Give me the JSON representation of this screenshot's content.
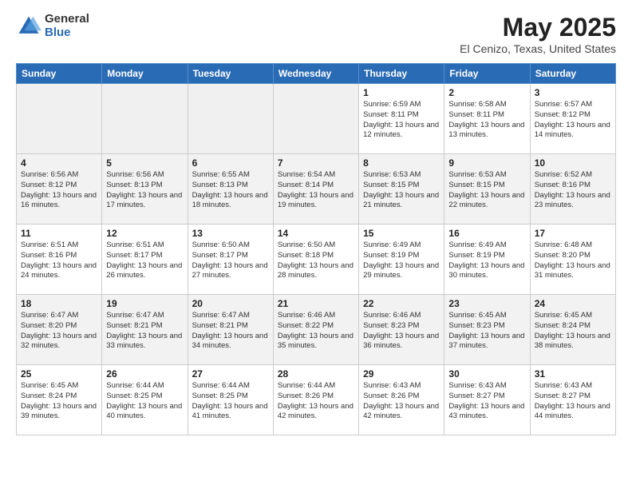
{
  "logo": {
    "general": "General",
    "blue": "Blue"
  },
  "title": {
    "month": "May 2025",
    "location": "El Cenizo, Texas, United States"
  },
  "weekdays": [
    "Sunday",
    "Monday",
    "Tuesday",
    "Wednesday",
    "Thursday",
    "Friday",
    "Saturday"
  ],
  "weeks": [
    [
      {
        "day": "",
        "info": ""
      },
      {
        "day": "",
        "info": ""
      },
      {
        "day": "",
        "info": ""
      },
      {
        "day": "",
        "info": ""
      },
      {
        "day": "1",
        "info": "Sunrise: 6:59 AM\nSunset: 8:11 PM\nDaylight: 13 hours and 12 minutes."
      },
      {
        "day": "2",
        "info": "Sunrise: 6:58 AM\nSunset: 8:11 PM\nDaylight: 13 hours and 13 minutes."
      },
      {
        "day": "3",
        "info": "Sunrise: 6:57 AM\nSunset: 8:12 PM\nDaylight: 13 hours and 14 minutes."
      }
    ],
    [
      {
        "day": "4",
        "info": "Sunrise: 6:56 AM\nSunset: 8:12 PM\nDaylight: 13 hours and 16 minutes."
      },
      {
        "day": "5",
        "info": "Sunrise: 6:56 AM\nSunset: 8:13 PM\nDaylight: 13 hours and 17 minutes."
      },
      {
        "day": "6",
        "info": "Sunrise: 6:55 AM\nSunset: 8:13 PM\nDaylight: 13 hours and 18 minutes."
      },
      {
        "day": "7",
        "info": "Sunrise: 6:54 AM\nSunset: 8:14 PM\nDaylight: 13 hours and 19 minutes."
      },
      {
        "day": "8",
        "info": "Sunrise: 6:53 AM\nSunset: 8:15 PM\nDaylight: 13 hours and 21 minutes."
      },
      {
        "day": "9",
        "info": "Sunrise: 6:53 AM\nSunset: 8:15 PM\nDaylight: 13 hours and 22 minutes."
      },
      {
        "day": "10",
        "info": "Sunrise: 6:52 AM\nSunset: 8:16 PM\nDaylight: 13 hours and 23 minutes."
      }
    ],
    [
      {
        "day": "11",
        "info": "Sunrise: 6:51 AM\nSunset: 8:16 PM\nDaylight: 13 hours and 24 minutes."
      },
      {
        "day": "12",
        "info": "Sunrise: 6:51 AM\nSunset: 8:17 PM\nDaylight: 13 hours and 26 minutes."
      },
      {
        "day": "13",
        "info": "Sunrise: 6:50 AM\nSunset: 8:17 PM\nDaylight: 13 hours and 27 minutes."
      },
      {
        "day": "14",
        "info": "Sunrise: 6:50 AM\nSunset: 8:18 PM\nDaylight: 13 hours and 28 minutes."
      },
      {
        "day": "15",
        "info": "Sunrise: 6:49 AM\nSunset: 8:19 PM\nDaylight: 13 hours and 29 minutes."
      },
      {
        "day": "16",
        "info": "Sunrise: 6:49 AM\nSunset: 8:19 PM\nDaylight: 13 hours and 30 minutes."
      },
      {
        "day": "17",
        "info": "Sunrise: 6:48 AM\nSunset: 8:20 PM\nDaylight: 13 hours and 31 minutes."
      }
    ],
    [
      {
        "day": "18",
        "info": "Sunrise: 6:47 AM\nSunset: 8:20 PM\nDaylight: 13 hours and 32 minutes."
      },
      {
        "day": "19",
        "info": "Sunrise: 6:47 AM\nSunset: 8:21 PM\nDaylight: 13 hours and 33 minutes."
      },
      {
        "day": "20",
        "info": "Sunrise: 6:47 AM\nSunset: 8:21 PM\nDaylight: 13 hours and 34 minutes."
      },
      {
        "day": "21",
        "info": "Sunrise: 6:46 AM\nSunset: 8:22 PM\nDaylight: 13 hours and 35 minutes."
      },
      {
        "day": "22",
        "info": "Sunrise: 6:46 AM\nSunset: 8:23 PM\nDaylight: 13 hours and 36 minutes."
      },
      {
        "day": "23",
        "info": "Sunrise: 6:45 AM\nSunset: 8:23 PM\nDaylight: 13 hours and 37 minutes."
      },
      {
        "day": "24",
        "info": "Sunrise: 6:45 AM\nSunset: 8:24 PM\nDaylight: 13 hours and 38 minutes."
      }
    ],
    [
      {
        "day": "25",
        "info": "Sunrise: 6:45 AM\nSunset: 8:24 PM\nDaylight: 13 hours and 39 minutes."
      },
      {
        "day": "26",
        "info": "Sunrise: 6:44 AM\nSunset: 8:25 PM\nDaylight: 13 hours and 40 minutes."
      },
      {
        "day": "27",
        "info": "Sunrise: 6:44 AM\nSunset: 8:25 PM\nDaylight: 13 hours and 41 minutes."
      },
      {
        "day": "28",
        "info": "Sunrise: 6:44 AM\nSunset: 8:26 PM\nDaylight: 13 hours and 42 minutes."
      },
      {
        "day": "29",
        "info": "Sunrise: 6:43 AM\nSunset: 8:26 PM\nDaylight: 13 hours and 42 minutes."
      },
      {
        "day": "30",
        "info": "Sunrise: 6:43 AM\nSunset: 8:27 PM\nDaylight: 13 hours and 43 minutes."
      },
      {
        "day": "31",
        "info": "Sunrise: 6:43 AM\nSunset: 8:27 PM\nDaylight: 13 hours and 44 minutes."
      }
    ]
  ]
}
